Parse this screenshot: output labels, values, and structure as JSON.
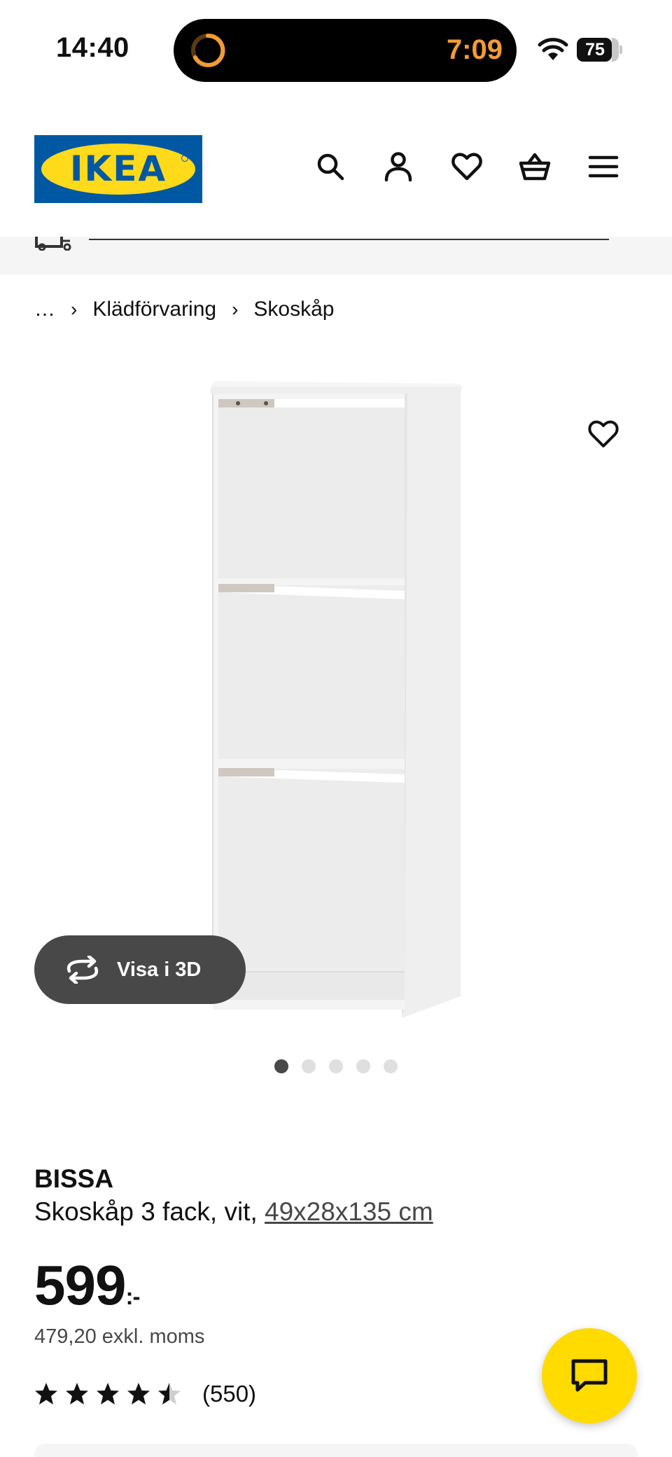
{
  "status_bar": {
    "time": "14:40",
    "live_activity_timer": "7:09",
    "battery_level": "75"
  },
  "header": {
    "logo_text": "IKEA",
    "icons": [
      "search-icon",
      "account-icon",
      "favourites-icon",
      "cart-icon",
      "menu-icon"
    ]
  },
  "breadcrumb": {
    "ellipsis": "…",
    "items": [
      "Klädförvaring",
      "Skoskåp"
    ]
  },
  "gallery": {
    "view_3d_label": "Visa i 3D",
    "image_count": 5,
    "active_index": 0
  },
  "product": {
    "name": "BISSA",
    "description": "Skoskåp 3 fack, vit,",
    "dimensions": "49x28x135 cm",
    "price": "599",
    "price_suffix": ":-",
    "price_excl_vat": "479,20 exkl. moms",
    "rating_stars": 4.5,
    "rating_count": "(550)"
  },
  "colors": {
    "ikea_blue": "#0058a3",
    "ikea_yellow": "#ffda1a",
    "chat_yellow": "#ffdb00",
    "timer_orange": "#f39c33"
  }
}
